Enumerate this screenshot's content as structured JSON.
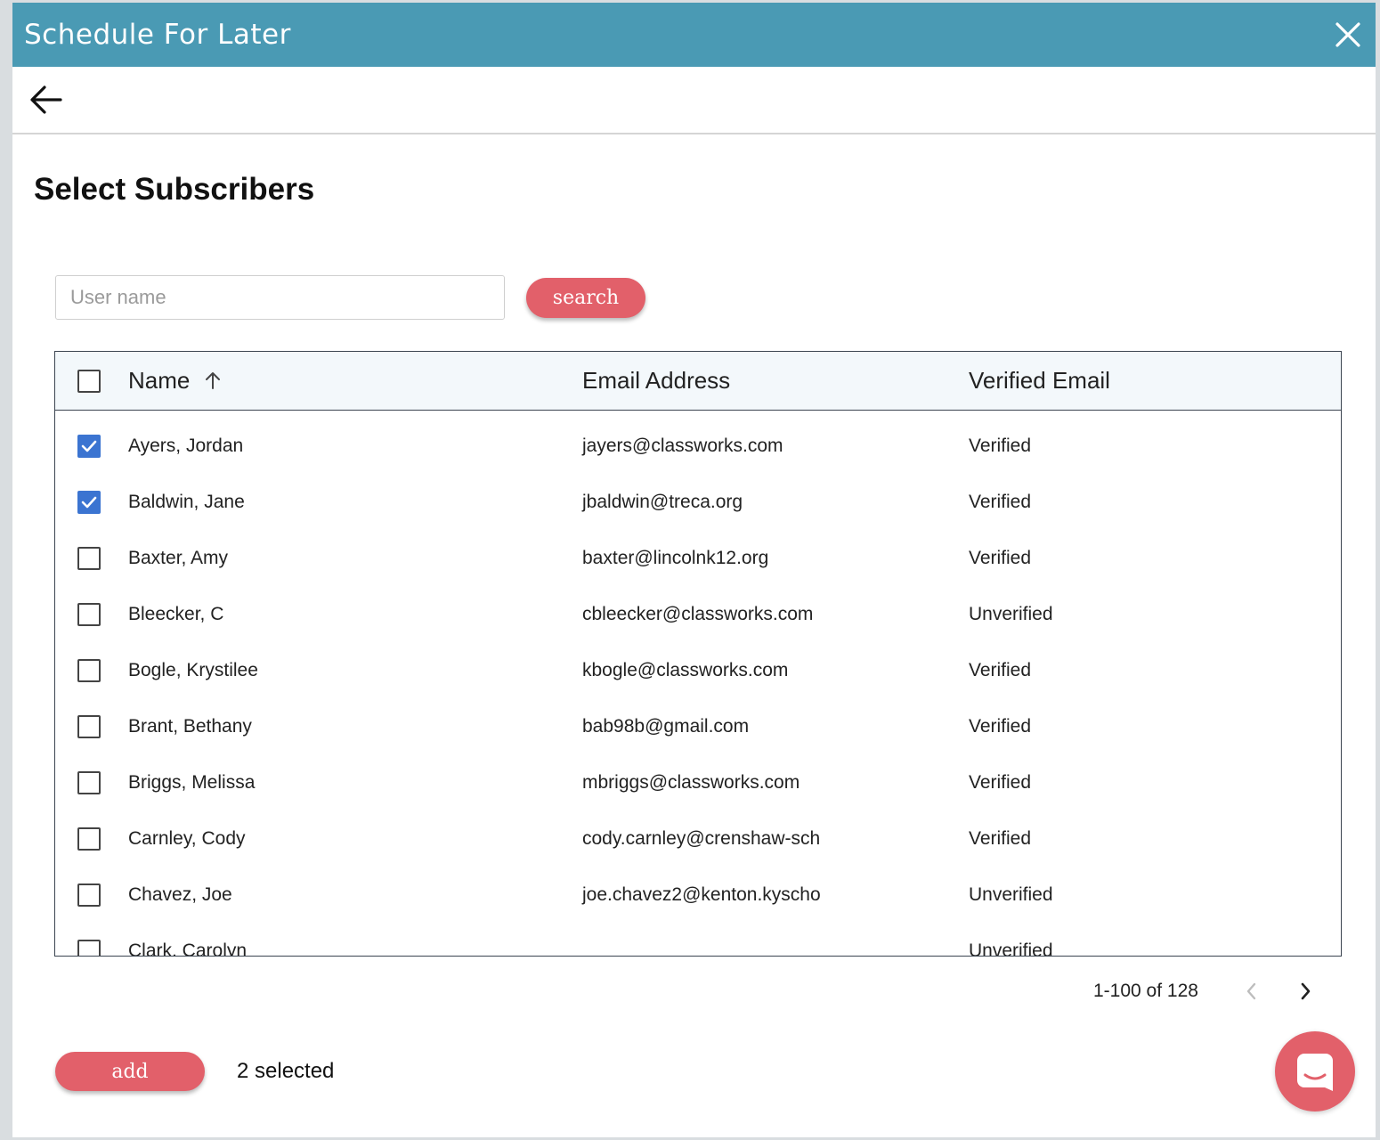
{
  "dialog": {
    "title": "Schedule For Later"
  },
  "page": {
    "heading": "Select Subscribers"
  },
  "search": {
    "placeholder": "User name",
    "value": "",
    "button_label": "search"
  },
  "table": {
    "headers": {
      "name": "Name",
      "email": "Email Address",
      "verified": "Verified Email"
    },
    "sort": {
      "column": "Name",
      "direction": "ascending"
    },
    "rows": [
      {
        "name": "Ayers, Jordan",
        "email": "jayers@classworks.com",
        "verified": "Verified",
        "checked": true
      },
      {
        "name": "Baldwin, Jane",
        "email": "jbaldwin@treca.org",
        "verified": "Verified",
        "checked": true
      },
      {
        "name": "Baxter, Amy",
        "email": "baxter@lincolnk12.org",
        "verified": "Verified",
        "checked": false
      },
      {
        "name": "Bleecker, C",
        "email": "cbleecker@classworks.com",
        "verified": "Unverified",
        "checked": false
      },
      {
        "name": "Bogle, Krystilee",
        "email": "kbogle@classworks.com",
        "verified": "Verified",
        "checked": false
      },
      {
        "name": "Brant, Bethany",
        "email": "bab98b@gmail.com",
        "verified": "Verified",
        "checked": false
      },
      {
        "name": "Briggs, Melissa",
        "email": "mbriggs@classworks.com",
        "verified": "Verified",
        "checked": false
      },
      {
        "name": "Carnley, Cody",
        "email": "cody.carnley@crenshaw-sch",
        "verified": "Verified",
        "checked": false
      },
      {
        "name": "Chavez, Joe",
        "email": "joe.chavez2@kenton.kyscho",
        "verified": "Unverified",
        "checked": false
      },
      {
        "name": "Clark, Carolyn",
        "email": "",
        "verified": "Unverified",
        "checked": false
      }
    ]
  },
  "pagination": {
    "range_text": "1-100 of 128"
  },
  "footer": {
    "add_label": "add",
    "selected_text": "2 selected"
  },
  "colors": {
    "header": "#4a9ab4",
    "accent": "#e2606a",
    "checkbox_checked": "#3b74d1"
  },
  "icons": {
    "close": "close-icon",
    "back": "arrow-left-icon",
    "sort": "arrow-up-icon",
    "prev": "chevron-left-icon",
    "next": "chevron-right-icon",
    "chat": "chat-icon"
  }
}
